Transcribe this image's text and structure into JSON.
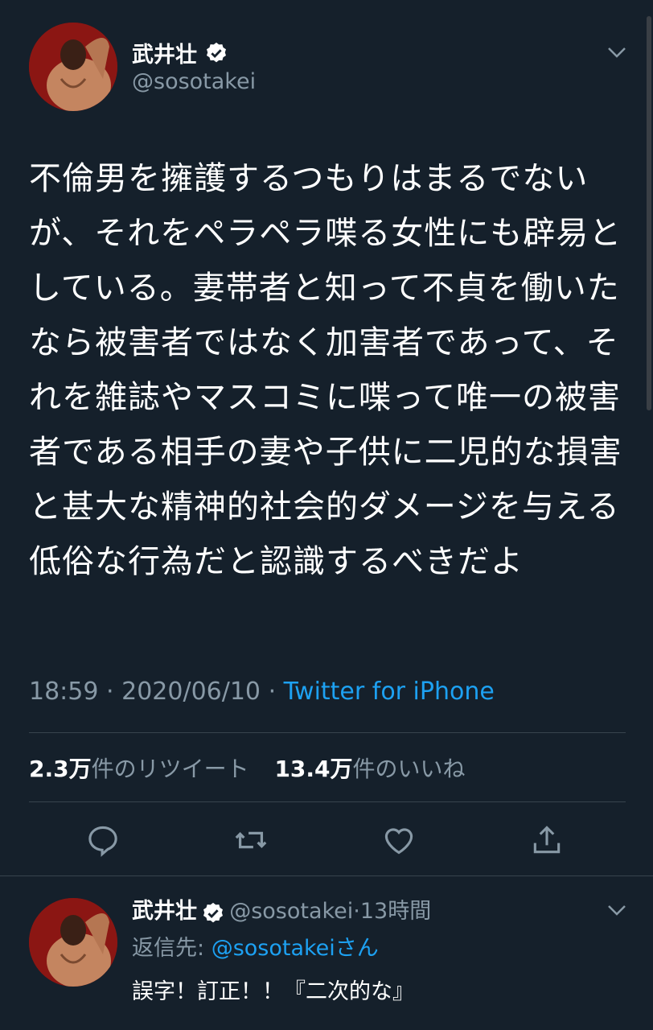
{
  "tweet": {
    "author_name": "武井壮",
    "author_handle": "@sosotakei",
    "text": "不倫男を擁護するつもりはまるでないが、それをペラペラ喋る女性にも辟易としている。妻帯者と知って不貞を働いたなら被害者ではなく加害者であって、それを雑誌やマスコミに喋って唯一の被害者である相手の妻や子供に二児的な損害と甚大な精神的社会的ダメージを与える低俗な行為だと認識するべきだよ",
    "time": "18:59",
    "date": "2020/06/10",
    "separator": "·",
    "source": "Twitter for iPhone",
    "retweets_count": "2.3万",
    "retweets_label": "件のリツイート",
    "likes_count": "13.4万",
    "likes_label": "件のいいね"
  },
  "actions": {
    "reply_icon": "reply-icon",
    "retweet_icon": "retweet-icon",
    "like_icon": "heart-icon",
    "share_icon": "share-icon"
  },
  "reply": {
    "author_name": "武井壮",
    "author_handle": "@sosotakei",
    "separator": "·",
    "age": "13時間",
    "reply_to_label": "返信先:",
    "reply_to_handle": "@sosotakei",
    "reply_to_suffix": "さん",
    "text": "誤字！訂正！！『二次的な』"
  },
  "colors": {
    "background": "#15202b",
    "accent": "#1da1f2",
    "secondary_text": "#8899a6",
    "divider": "#38444d"
  }
}
